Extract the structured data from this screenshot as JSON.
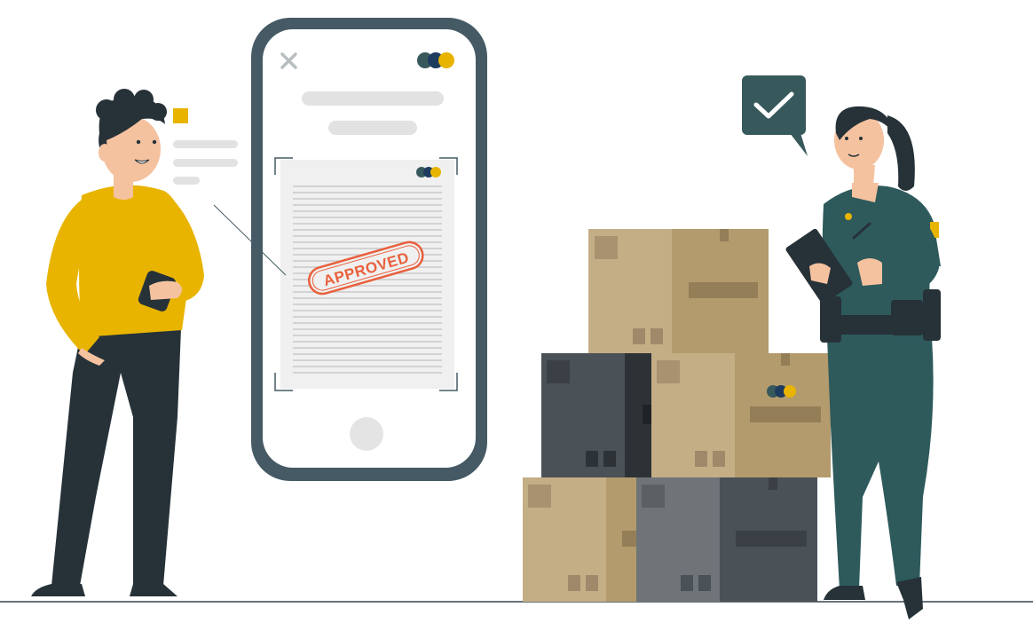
{
  "stamp": {
    "label": "APPROVED"
  },
  "colors": {
    "accent_yellow": "#E8B400",
    "frame_dark": "#455A64",
    "stamp_red": "#E8603C",
    "officer_green": "#2E5A5C",
    "box_tan": "#C4AE86",
    "box_dark": "#4A5157",
    "box_grey": "#6E7478"
  },
  "icons": {
    "close": "close-icon",
    "logo": "brand-logo-dots",
    "home": "home-button-circle",
    "check": "checkmark-icon"
  }
}
